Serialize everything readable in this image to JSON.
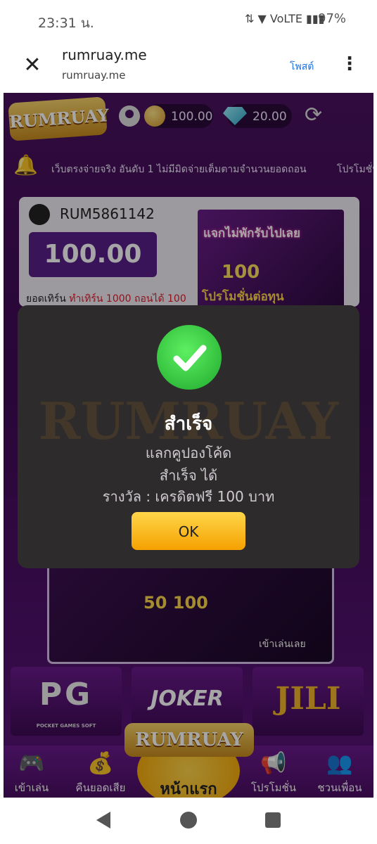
{
  "status_bar": {
    "time": "23:31 น.",
    "icons": "⇅ ▼ VoLTE ▮▮▮",
    "battery": "97%"
  },
  "browser": {
    "title": "rumruay.me",
    "url": "rumruay.me",
    "share_label": "โพสต์"
  },
  "header": {
    "logo": "RUMRUAY",
    "coins": "100.00",
    "gems": "20.00"
  },
  "ticker": {
    "text": "เว็บตรงจ่ายจริง อันดับ 1 ไม่มีมิดจ่ายเต็มตามจำนวนยอดถอน",
    "promo_tab": "โปรโมชั่น"
  },
  "user_card": {
    "username": "RUM5861142",
    "balance": "100.00",
    "turnover_label": "ยอดเทิร์น",
    "turnover_value": "ทำเทิร์น 1000 ถอนได้ 100",
    "promo_line1": "แจกไม่พักรับไปเลย",
    "promo_amount": "100",
    "promo_line2": "โปรโมชั่นต่อทุน"
  },
  "lower_banner": {
    "amount": "50 100",
    "play_label": "เข้าเล่นเลย"
  },
  "providers": {
    "pg": "PG",
    "pg_sub": "POCKET GAMES SOFT",
    "joker": "JOKER",
    "jili": "JILI"
  },
  "bottom_nav": {
    "play": "เข้าเล่น",
    "refund": "คืนยอดเสีย",
    "home": "หน้าแรก",
    "promo": "โปรโมชั่น",
    "friend": "ชวนเพื่อน",
    "logo": "RUMRUAY"
  },
  "modal": {
    "title": "สำเร็จ",
    "line1": "แลกคูปองโค้ด",
    "line2": "สำเร็จ ได้",
    "line3": "รางวัล : เครดิตฟรี 100 บาท",
    "ok_label": "OK",
    "watermark": "RUMRUAY"
  },
  "colors": {
    "accent": "#5a1f88",
    "success": "#2fc23a",
    "ok_button": "#f5a100"
  }
}
